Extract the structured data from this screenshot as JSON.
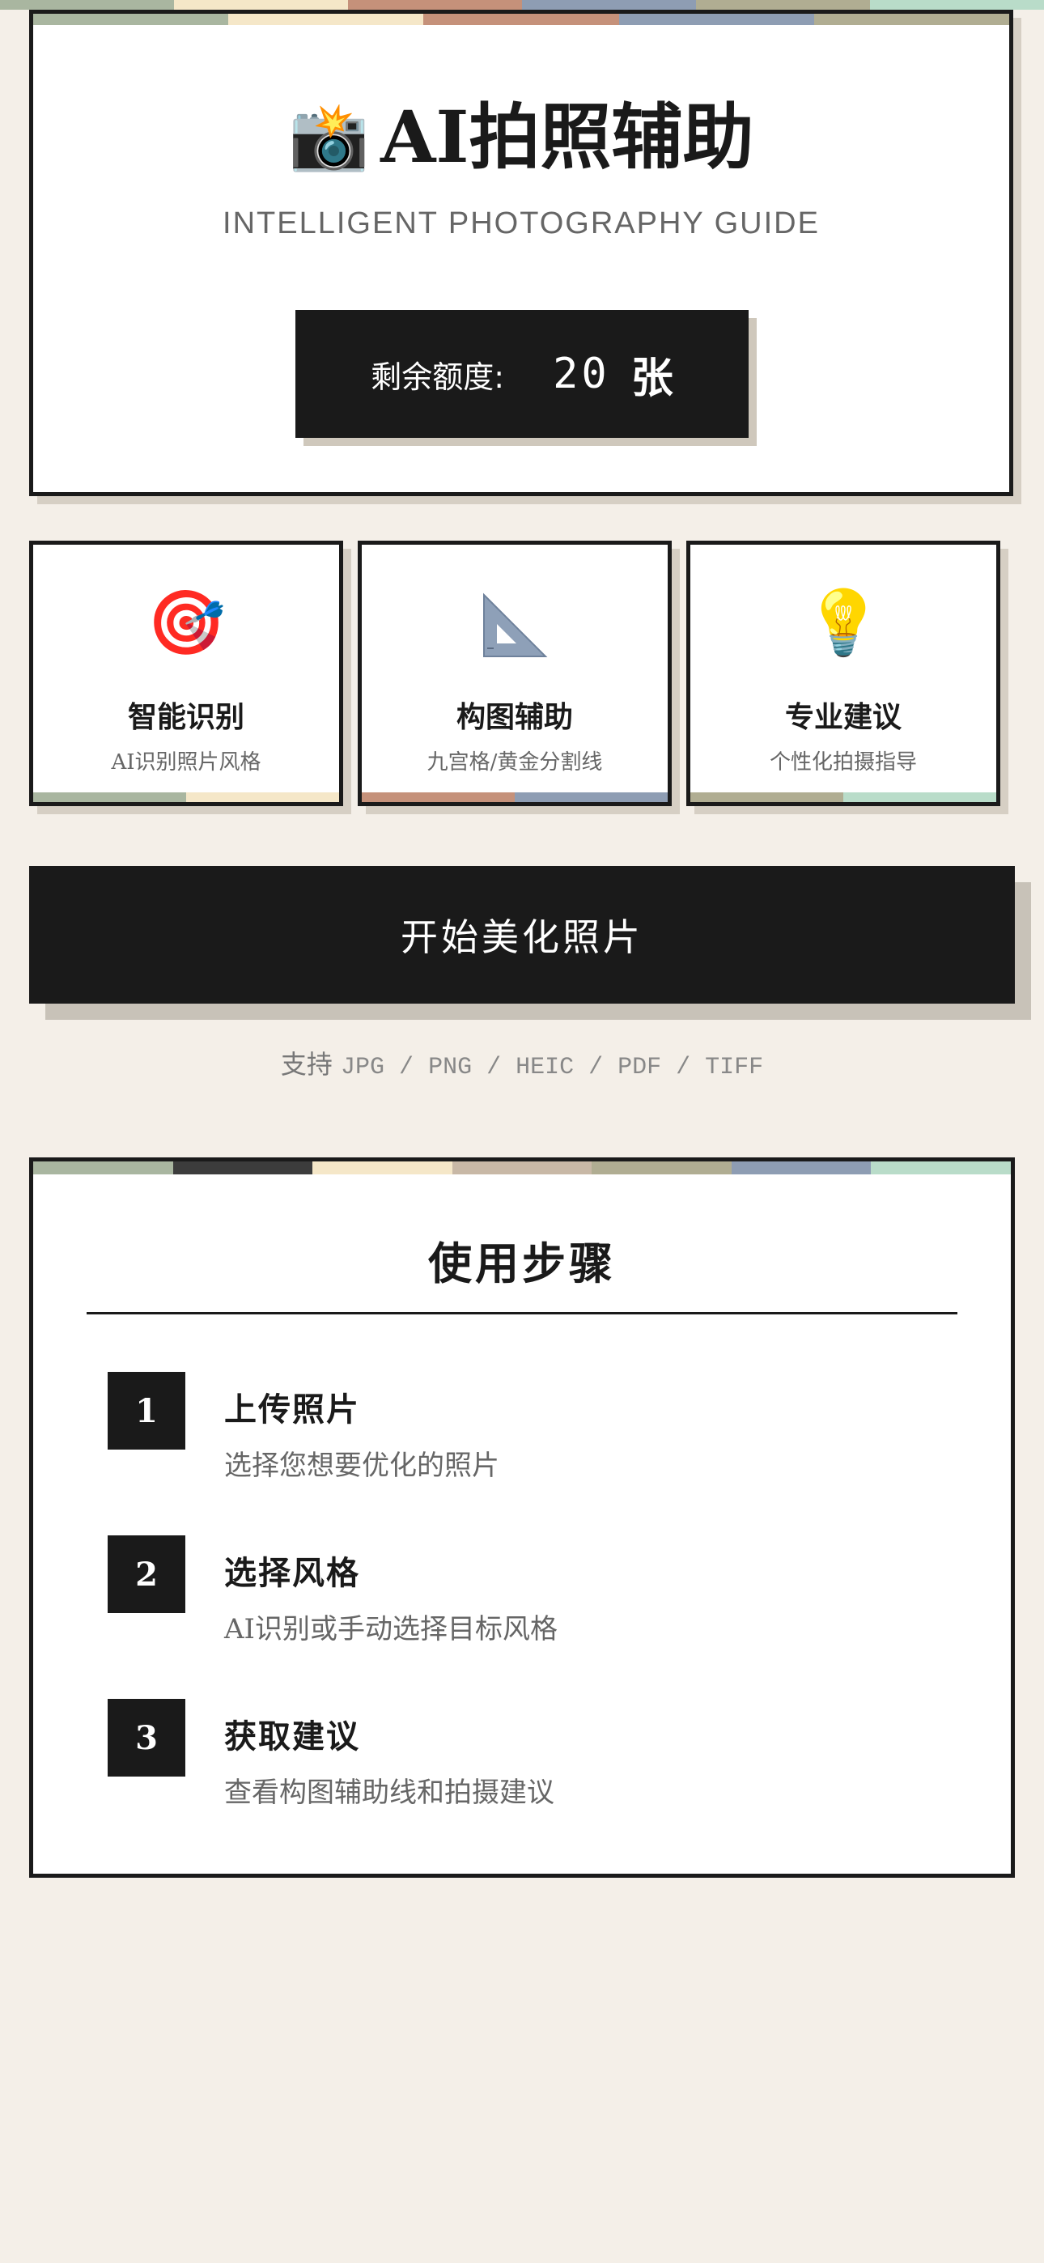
{
  "top_palette": [
    "#a9b6a0",
    "#f5e7c8",
    "#c5917a",
    "#8e9db3",
    "#b0ad92",
    "#b9dcc9"
  ],
  "hero": {
    "icon": "camera-with-flash",
    "icon_glyph": "📸",
    "title": "AI拍照辅助",
    "subtitle": "INTELLIGENT PHOTOGRAPHY GUIDE",
    "quota_label": "剩余额度:",
    "quota_value": "20",
    "quota_unit": "张"
  },
  "features": [
    {
      "icon": "dart-target-icon",
      "glyph": "🎯",
      "title": "智能识别",
      "desc": "AI识别照片风格",
      "colors": [
        "#a9b6a0",
        "#f5e7c8"
      ]
    },
    {
      "icon": "triangle-ruler-icon",
      "glyph": "",
      "title": "构图辅助",
      "desc": "九宫格/黄金分割线",
      "colors": [
        "#c5917a",
        "#8e9db3"
      ]
    },
    {
      "icon": "light-bulb-icon",
      "glyph": "💡",
      "title": "专业建议",
      "desc": "个性化拍摄指导",
      "colors": [
        "#b0ad92",
        "#b9dcc9"
      ]
    }
  ],
  "start_button": "开始美化照片",
  "support": {
    "label": "支持",
    "formats": "JPG / PNG / HEIC / PDF / TIFF"
  },
  "steps_palette": [
    "#a9b6a0",
    "#3c3c3c",
    "#f5e7c8",
    "#c8b8a6",
    "#b0ad92",
    "#8e9db3",
    "#b9dcc9"
  ],
  "steps": {
    "title": "使用步骤",
    "items": [
      {
        "num": "1",
        "title": "上传照片",
        "desc": "选择您想要优化的照片"
      },
      {
        "num": "2",
        "title": "选择风格",
        "desc": "AI识别或手动选择目标风格"
      },
      {
        "num": "3",
        "title": "获取建议",
        "desc": "查看构图辅助线和拍摄建议"
      }
    ]
  }
}
